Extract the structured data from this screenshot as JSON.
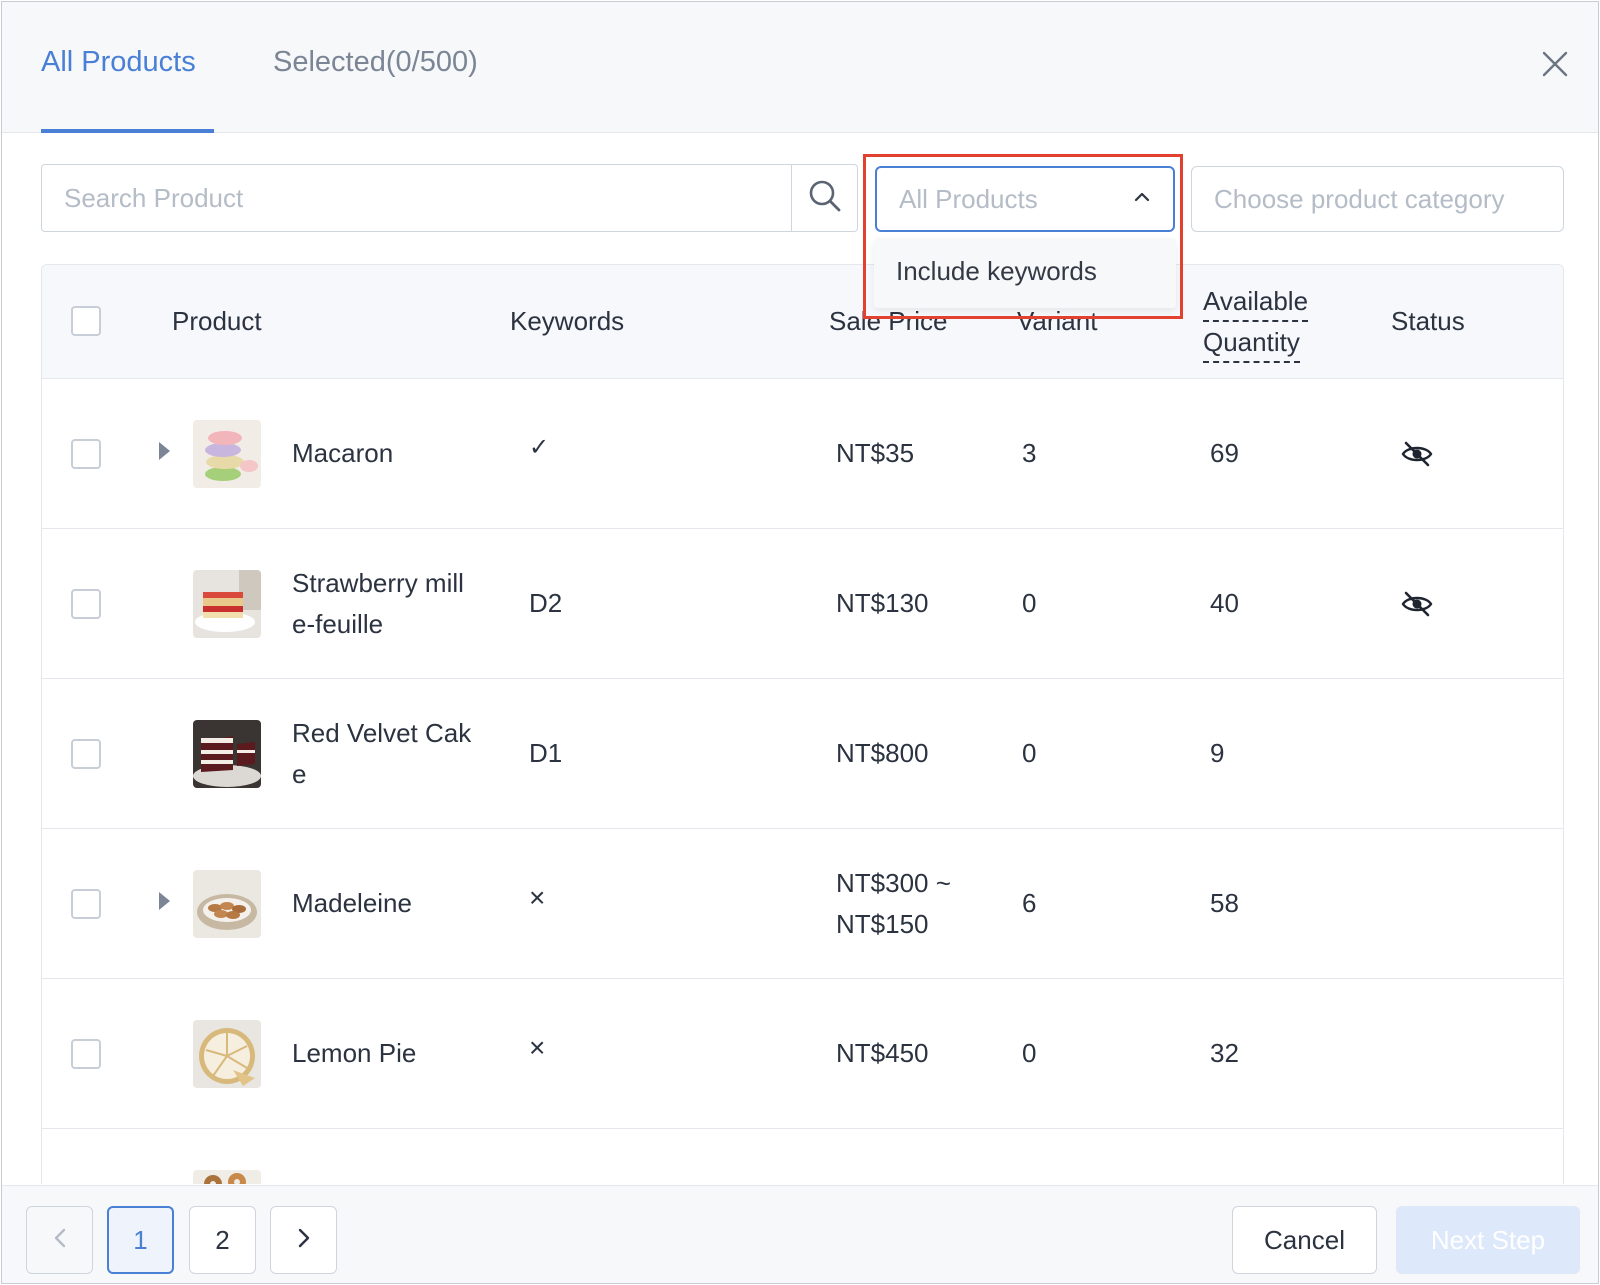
{
  "tabs": {
    "all_label": "All Products",
    "selected_label": "Selected(0/500)"
  },
  "search": {
    "placeholder": "Search Product"
  },
  "filter": {
    "value": "All Products",
    "options": [
      "Include keywords"
    ]
  },
  "category": {
    "placeholder": "Choose product category"
  },
  "table": {
    "headers": {
      "product": "Product",
      "keywords": "Keywords",
      "sale_price": "Sale Price",
      "variant": "Variant",
      "available": "Available",
      "quantity": "Quantity",
      "status": "Status"
    },
    "rows": [
      {
        "name": "Macaron",
        "keywords": "✓",
        "price": "NT$35",
        "variant": "3",
        "quantity": "69",
        "expandable": true,
        "hidden": true
      },
      {
        "name": "Strawberry mill e-feuille",
        "keywords": "D2",
        "price": "NT$130",
        "variant": "0",
        "quantity": "40",
        "expandable": false,
        "hidden": true
      },
      {
        "name": "Red Velvet Cak e",
        "keywords": "D1",
        "price": "NT$800",
        "variant": "0",
        "quantity": "9",
        "expandable": false,
        "hidden": false
      },
      {
        "name": "Madeleine",
        "keywords": "×",
        "price": "NT$300 ~ NT$150",
        "variant": "6",
        "quantity": "58",
        "expandable": true,
        "hidden": false
      },
      {
        "name": "Lemon Pie",
        "keywords": "×",
        "price": "NT$450",
        "variant": "0",
        "quantity": "32",
        "expandable": false,
        "hidden": false
      }
    ]
  },
  "pagination": {
    "pages": [
      "1",
      "2"
    ],
    "current": "1"
  },
  "footer": {
    "cancel_label": "Cancel",
    "next_label": "Next Step"
  },
  "colors": {
    "accent": "#4a7fd6",
    "highlight": "#e2412f"
  },
  "icons": {
    "close": "close-icon",
    "search": "search-icon",
    "chevron": "chevron-up-icon",
    "status": "eye-off-icon"
  }
}
